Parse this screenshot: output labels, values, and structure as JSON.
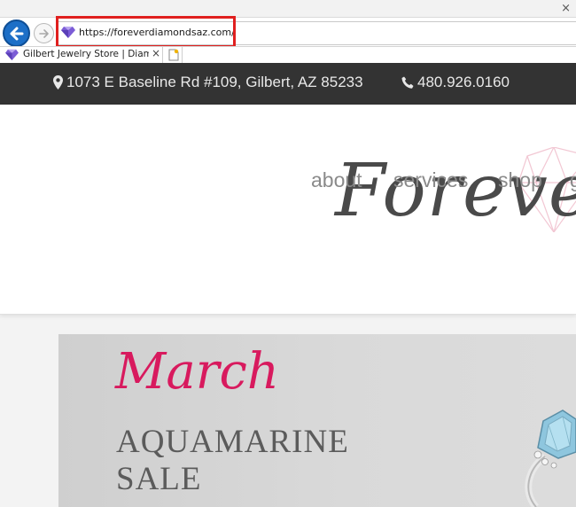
{
  "browser": {
    "window_close_glyph": "×",
    "address": {
      "url": "https://foreverdiamondsaz.com/"
    },
    "tab": {
      "title": "Gilbert Jewelry Store | Diam...",
      "close_glyph": "×"
    }
  },
  "topbar": {
    "address": "1073 E Baseline Rd #109, Gilbert, AZ 85233",
    "phone": "480.926.0160",
    "icons": {
      "address": "map-marker-icon",
      "phone": "phone-icon"
    }
  },
  "header": {
    "logo_text": "Forever",
    "nav": [
      {
        "label": "about"
      },
      {
        "label": "services"
      },
      {
        "label": "shop"
      },
      {
        "label": "g"
      }
    ]
  },
  "banner": {
    "month": "March",
    "line1": "AQUAMARINE",
    "line2": "SALE"
  },
  "colors": {
    "topbar_bg": "#333333",
    "accent_pink": "#d81a5e",
    "highlight_red": "#e0201f",
    "back_button_blue": "#1d6fc7"
  }
}
